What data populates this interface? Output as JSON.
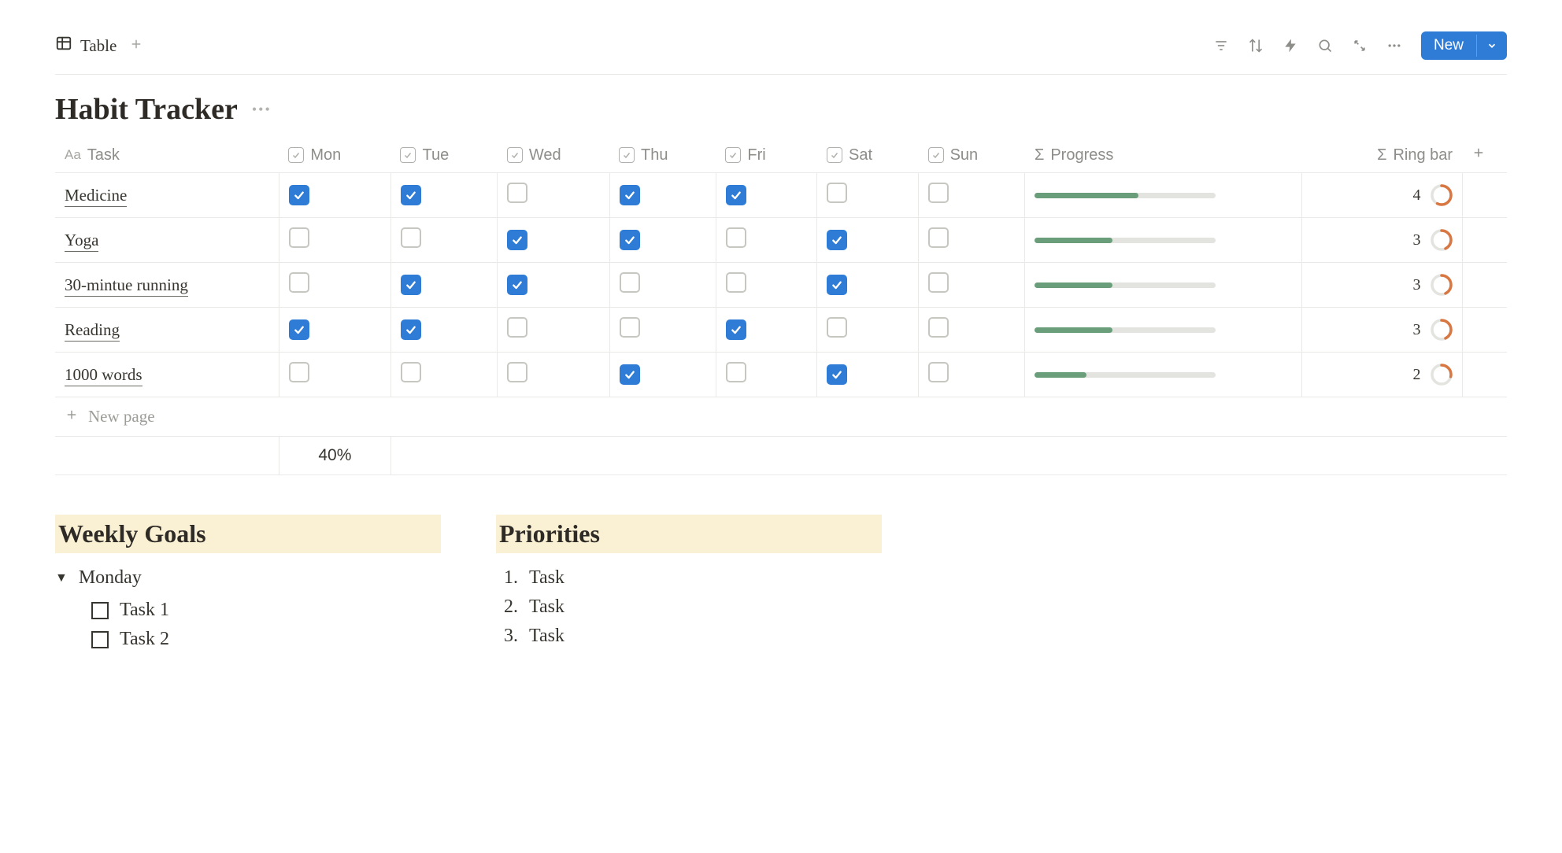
{
  "view": {
    "name": "Table"
  },
  "toolbar": {
    "new_label": "New"
  },
  "title": "Habit Tracker",
  "columns": {
    "task": "Task",
    "days": [
      "Mon",
      "Tue",
      "Wed",
      "Thu",
      "Fri",
      "Sat",
      "Sun"
    ],
    "progress": "Progress",
    "ringbar": "Ring bar"
  },
  "rows": [
    {
      "name": "Medicine",
      "checks": [
        true,
        true,
        false,
        true,
        true,
        false,
        false
      ],
      "count": 4
    },
    {
      "name": "Yoga",
      "checks": [
        false,
        false,
        true,
        true,
        false,
        true,
        false
      ],
      "count": 3
    },
    {
      "name": "30-mintue running",
      "checks": [
        false,
        true,
        true,
        false,
        false,
        true,
        false
      ],
      "count": 3
    },
    {
      "name": "Reading",
      "checks": [
        true,
        true,
        false,
        false,
        true,
        false,
        false
      ],
      "count": 3
    },
    {
      "name": "1000 words",
      "checks": [
        false,
        false,
        false,
        true,
        false,
        true,
        false
      ],
      "count": 2
    }
  ],
  "new_page_label": "New page",
  "footer_percent": "40%",
  "weekly_goals": {
    "heading": "Weekly Goals",
    "toggle_label": "Monday",
    "tasks": [
      "Task 1",
      "Task 2"
    ]
  },
  "priorities": {
    "heading": "Priorities",
    "items": [
      "Task",
      "Task",
      "Task"
    ]
  }
}
